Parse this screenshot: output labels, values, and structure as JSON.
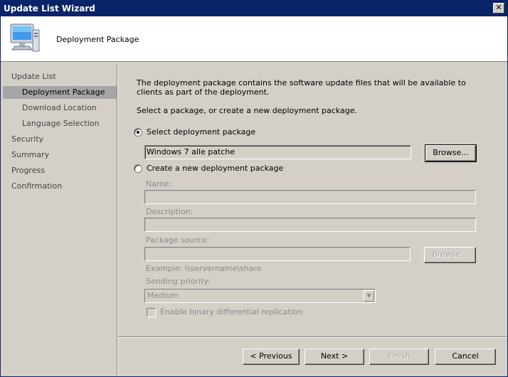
{
  "window": {
    "title": "Update List Wizard",
    "close_glyph": "✕"
  },
  "header": {
    "title": "Deployment Package",
    "icon": "computer-icon"
  },
  "sidebar": {
    "items": [
      {
        "label": "Update List",
        "active": false,
        "sub": false
      },
      {
        "label": "Deployment Package",
        "active": true,
        "sub": true
      },
      {
        "label": "Download Location",
        "active": false,
        "sub": true
      },
      {
        "label": "Language Selection",
        "active": false,
        "sub": true
      },
      {
        "label": "Security",
        "active": false,
        "sub": false
      },
      {
        "label": "Summary",
        "active": false,
        "sub": false
      },
      {
        "label": "Progress",
        "active": false,
        "sub": false
      },
      {
        "label": "Confirmation",
        "active": false,
        "sub": false
      }
    ]
  },
  "content": {
    "description": "The deployment package contains the software update files that will be available to clients as part of the deployment.",
    "instruction": "Select a package, or create a new deployment package.",
    "select_option": {
      "label": "Select deployment package",
      "checked": true,
      "value": "Windows 7 alle patche",
      "browse_label": "Browse..."
    },
    "create_option": {
      "label": "Create a new deployment package",
      "checked": false,
      "name_label": "Name:",
      "name_value": "",
      "description_label": "Description:",
      "description_value": "",
      "source_label": "Package source:",
      "source_value": "",
      "browse_label": "Browse...",
      "example": "Example: \\\\servername\\share",
      "priority_label": "Sending priority:",
      "priority_value": "Medium",
      "binary_diff_label": "Enable binary differential replication",
      "binary_diff_checked": false
    }
  },
  "footer": {
    "previous_label": "< Previous",
    "next_label": "Next >",
    "finish_label": "Finish",
    "cancel_label": "Cancel"
  },
  "colors": {
    "title_bar": "#0a246a",
    "dialog_bg": "#d4d0c8",
    "active_item": "#a6a6a6",
    "disabled_text": "#8c8c8c"
  }
}
